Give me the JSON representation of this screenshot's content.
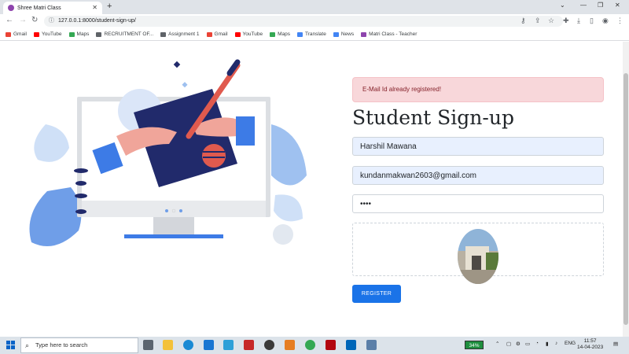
{
  "browser": {
    "tab_title": "Shree Matri Class",
    "url": "127.0.0.1:8000/student-sign-up/",
    "bookmarks": [
      {
        "label": "Gmail",
        "color": "#ea4335"
      },
      {
        "label": "YouTube",
        "color": "#ff0000"
      },
      {
        "label": "Maps",
        "color": "#34a853"
      },
      {
        "label": "RECRUITMENT OF...",
        "color": "#5f6368"
      },
      {
        "label": "Assignment 1",
        "color": "#5f6368"
      },
      {
        "label": "Gmail",
        "color": "#ea4335"
      },
      {
        "label": "YouTube",
        "color": "#ff0000"
      },
      {
        "label": "Maps",
        "color": "#34a853"
      },
      {
        "label": "Translate",
        "color": "#4285f4"
      },
      {
        "label": "News",
        "color": "#4285f4"
      },
      {
        "label": "Matri Class - Teacher",
        "color": "#8e44ad"
      }
    ]
  },
  "signup": {
    "alert": "E-Mail Id already registered!",
    "heading": "Student Sign-up",
    "name_value": "Harshil Mawana",
    "email_value": "kundanmakwan2603@gmail.com",
    "password_value": "••••",
    "register_label": "REGISTER"
  },
  "taskbar": {
    "search_placeholder": "Type here to search",
    "battery": "34%",
    "language": "ENG",
    "time": "11:57",
    "date": "14-04-2023"
  },
  "colors": {
    "accent": "#1a73e8",
    "alert_bg": "#f8d7da",
    "alert_text": "#842029",
    "autofill_bg": "#e8f0fe"
  }
}
